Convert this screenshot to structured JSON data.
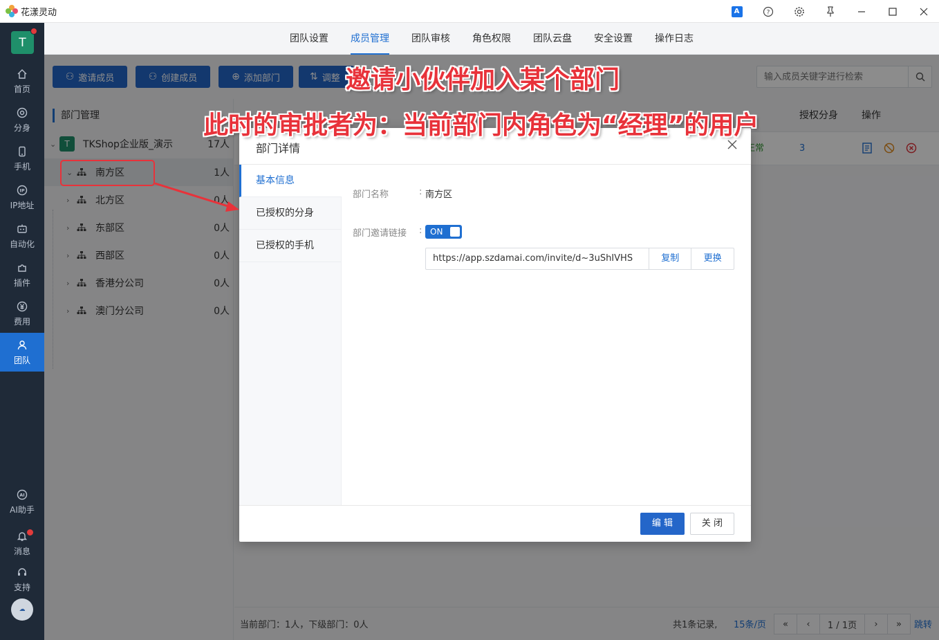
{
  "window": {
    "title": "花漾灵动"
  },
  "sidebar": {
    "avatar_letter": "T",
    "items": [
      {
        "label": "首页",
        "icon": "home-icon"
      },
      {
        "label": "分身",
        "icon": "browser-icon"
      },
      {
        "label": "手机",
        "icon": "phone-icon"
      },
      {
        "label": "IP地址",
        "icon": "ip-icon"
      },
      {
        "label": "自动化",
        "icon": "robot-icon"
      },
      {
        "label": "插件",
        "icon": "puzzle-icon"
      },
      {
        "label": "费用",
        "icon": "yen-icon"
      },
      {
        "label": "团队",
        "icon": "team-icon"
      }
    ],
    "bottom_items": [
      {
        "label": "AI助手",
        "icon": "ai-icon"
      },
      {
        "label": "消息",
        "icon": "bell-icon"
      },
      {
        "label": "支持",
        "icon": "headset-icon"
      }
    ],
    "active": "团队"
  },
  "tabs": [
    "团队设置",
    "成员管理",
    "团队审核",
    "角色权限",
    "团队云盘",
    "安全设置",
    "操作日志"
  ],
  "active_tab": "成员管理",
  "toolbar": {
    "invite": "邀请成员",
    "create": "创建成员",
    "add_dept": "添加部门",
    "adjust": "调整",
    "search_placeholder": "输入成员关键字进行检索"
  },
  "dept_panel": {
    "title": "部门管理",
    "root": {
      "badge": "T",
      "name": "TKShop企业版_演示",
      "count": "17人"
    },
    "children": [
      {
        "name": "南方区",
        "count": "1人"
      },
      {
        "name": "北方区",
        "count": "0人"
      },
      {
        "name": "东部区",
        "count": "0人"
      },
      {
        "name": "西部区",
        "count": "0人"
      },
      {
        "name": "香港分公司",
        "count": "0人"
      },
      {
        "name": "澳门分公司",
        "count": "0人"
      }
    ]
  },
  "table": {
    "headers": {
      "auth": "授权分身",
      "ops": "操作"
    },
    "row": {
      "status": "正常",
      "auth_count": "3"
    }
  },
  "footer": {
    "info": "当前部门：1人，下级部门：0人",
    "total": "共1条记录,",
    "page_size": "15条/页",
    "page": "1 / 1页",
    "jump": "跳转"
  },
  "modal": {
    "title": "部门详情",
    "menu": [
      "基本信息",
      "已授权的分身",
      "已授权的手机"
    ],
    "name_label": "部门名称",
    "name_value": "南方区",
    "invite_label": "部门邀请链接",
    "toggle": "ON",
    "invite_link": "https://app.szdamai.com/invite/d~3uShIVHS",
    "copy": "复制",
    "replace": "更换",
    "edit": "编 辑",
    "close": "关 闭"
  },
  "annotations": {
    "line1": "邀请小伙伴加入某个部门",
    "line2": "此时的审批者为：当前部门内角色为“经理”的用户"
  },
  "colors": {
    "accent": "#1f6fd1",
    "sidebar_bg": "#1f2a38",
    "annotation": "#e8323a"
  }
}
